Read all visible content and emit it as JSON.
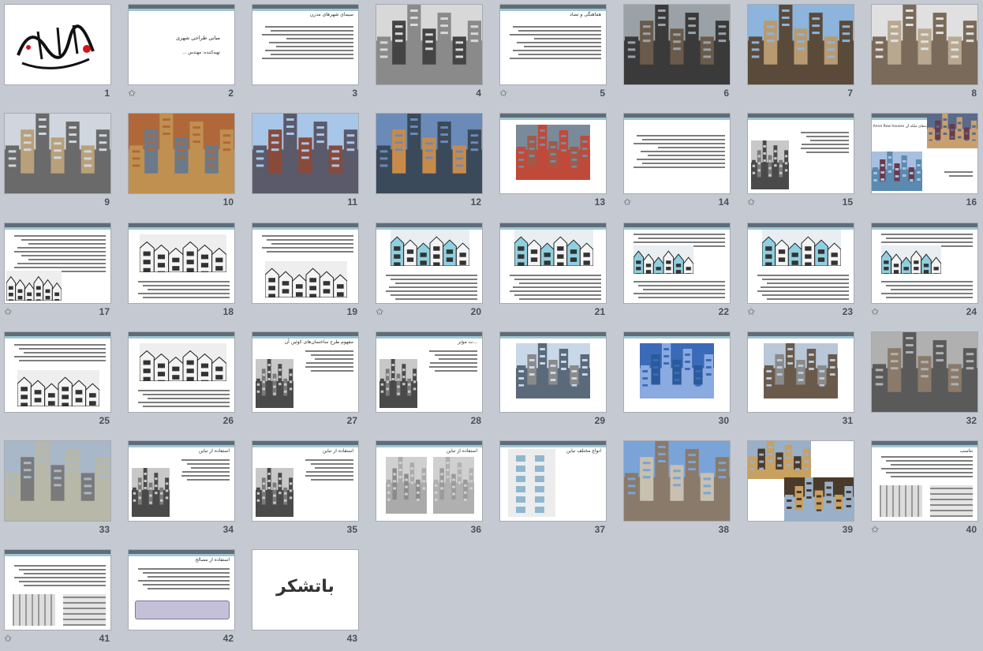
{
  "slides": [
    {
      "n": "1",
      "kind": "calligraphy",
      "star": false
    },
    {
      "n": "2",
      "kind": "title",
      "title": "مبانی طراحی شهری",
      "sub": "تهیه‌کننده: مهندس ...",
      "star": true
    },
    {
      "n": "3",
      "kind": "text",
      "title": "سیمای شهرهای مدرن",
      "star": false
    },
    {
      "n": "4",
      "kind": "photo",
      "palette": [
        "#d8d8d8",
        "#444444",
        "#8a8a8a"
      ],
      "star": false
    },
    {
      "n": "5",
      "kind": "text",
      "title": "هماهنگی و تضاد",
      "star": true
    },
    {
      "n": "6",
      "kind": "photo",
      "palette": [
        "#9aa2a8",
        "#6a5a4a",
        "#3a3a3a"
      ],
      "star": false
    },
    {
      "n": "7",
      "kind": "photo",
      "palette": [
        "#8cb4dc",
        "#b89a70",
        "#5a4a3a"
      ],
      "star": false
    },
    {
      "n": "8",
      "kind": "photo",
      "palette": [
        "#e0e0e0",
        "#b8a890",
        "#7a6a5a"
      ],
      "star": false
    },
    {
      "n": "9",
      "kind": "photo",
      "palette": [
        "#cfd6de",
        "#b8a07a",
        "#6a6a6a"
      ],
      "star": false
    },
    {
      "n": "10",
      "kind": "photo",
      "palette": [
        "#b0683a",
        "#6a7a8a",
        "#c09050"
      ],
      "star": false
    },
    {
      "n": "11",
      "kind": "photo",
      "palette": [
        "#a8c6e8",
        "#8a4a3a",
        "#5a5a6a"
      ],
      "star": false
    },
    {
      "n": "12",
      "kind": "photo",
      "palette": [
        "#6a8ab8",
        "#c88a4a",
        "#3a4a5a"
      ],
      "star": false
    },
    {
      "n": "13",
      "kind": "photo-inset",
      "palette": [
        "#7a8a9a",
        "#a05a4a",
        "#c04a3a"
      ],
      "star": false
    },
    {
      "n": "14",
      "kind": "text",
      "title": "",
      "star": true
    },
    {
      "n": "15",
      "kind": "text-photo",
      "title": "",
      "star": true
    },
    {
      "n": "16",
      "kind": "title-photos",
      "title": "خانه‌های ملکه آن Queen Anne Row houses",
      "star": false
    },
    {
      "n": "17",
      "kind": "text-sketch",
      "title": "",
      "star": true
    },
    {
      "n": "18",
      "kind": "sketch",
      "title": "",
      "star": false
    },
    {
      "n": "19",
      "kind": "sketch-text",
      "title": "",
      "star": false
    },
    {
      "n": "20",
      "kind": "sketch-blue",
      "title": "",
      "star": true
    },
    {
      "n": "21",
      "kind": "sketch-blue",
      "title": "",
      "star": false
    },
    {
      "n": "22",
      "kind": "sketch-blue-text",
      "title": "",
      "star": false
    },
    {
      "n": "23",
      "kind": "sketch-blue",
      "title": "",
      "star": true
    },
    {
      "n": "24",
      "kind": "sketch-blue-text",
      "title": "",
      "star": true
    },
    {
      "n": "25",
      "kind": "sketch-text",
      "title": "",
      "star": false
    },
    {
      "n": "26",
      "kind": "sketch",
      "title": "",
      "star": false
    },
    {
      "n": "27",
      "kind": "text-photo",
      "title": "مفهوم طرح ساختمان‌های کوئین آن",
      "star": false
    },
    {
      "n": "28",
      "kind": "text-photo",
      "title": "...ت مؤثر",
      "star": false
    },
    {
      "n": "29",
      "kind": "photo-inset",
      "palette": [
        "#c8d8e8",
        "#8a8a8a",
        "#5a6a7a"
      ],
      "star": false
    },
    {
      "n": "30",
      "kind": "photo-inset",
      "palette": [
        "#3a6ab8",
        "#2a5a9a",
        "#8aaae0"
      ],
      "star": false
    },
    {
      "n": "31",
      "kind": "photo-inset",
      "palette": [
        "#b8c8d8",
        "#8a8a8a",
        "#6a5a4a"
      ],
      "star": false
    },
    {
      "n": "32",
      "kind": "photo",
      "palette": [
        "#b0b0b0",
        "#8a7a6a",
        "#5a5a5a"
      ],
      "star": false
    },
    {
      "n": "33",
      "kind": "photo",
      "palette": [
        "#a8b8c8",
        "#7a7a7a",
        "#b8b8a8"
      ],
      "star": false
    },
    {
      "n": "34",
      "kind": "text-photo",
      "title": "استفاده از تباین",
      "star": false
    },
    {
      "n": "35",
      "kind": "text-photo",
      "title": "استفاده از تباین",
      "star": false
    },
    {
      "n": "36",
      "kind": "sketch-grey",
      "title": "استفاده از تباین",
      "star": false
    },
    {
      "n": "37",
      "kind": "diagram",
      "title": "انواع مختلف تباین",
      "star": false
    },
    {
      "n": "38",
      "kind": "photo",
      "palette": [
        "#7aa4d8",
        "#c8c0b0",
        "#8a7a6a"
      ],
      "star": false
    },
    {
      "n": "39",
      "kind": "photo-pair",
      "palette": [
        "#9ab0c8",
        "#4a3a2a",
        "#c8a060"
      ],
      "star": false
    },
    {
      "n": "40",
      "kind": "text-diagram",
      "title": "تناسب",
      "star": true
    },
    {
      "n": "41",
      "kind": "text-diagram",
      "title": "",
      "star": true
    },
    {
      "n": "42",
      "kind": "text-box",
      "title": "استفاده از مصالح",
      "star": false
    },
    {
      "n": "43",
      "kind": "thanks",
      "title": "باتشکر",
      "star": false
    }
  ],
  "star_glyph": "✩"
}
